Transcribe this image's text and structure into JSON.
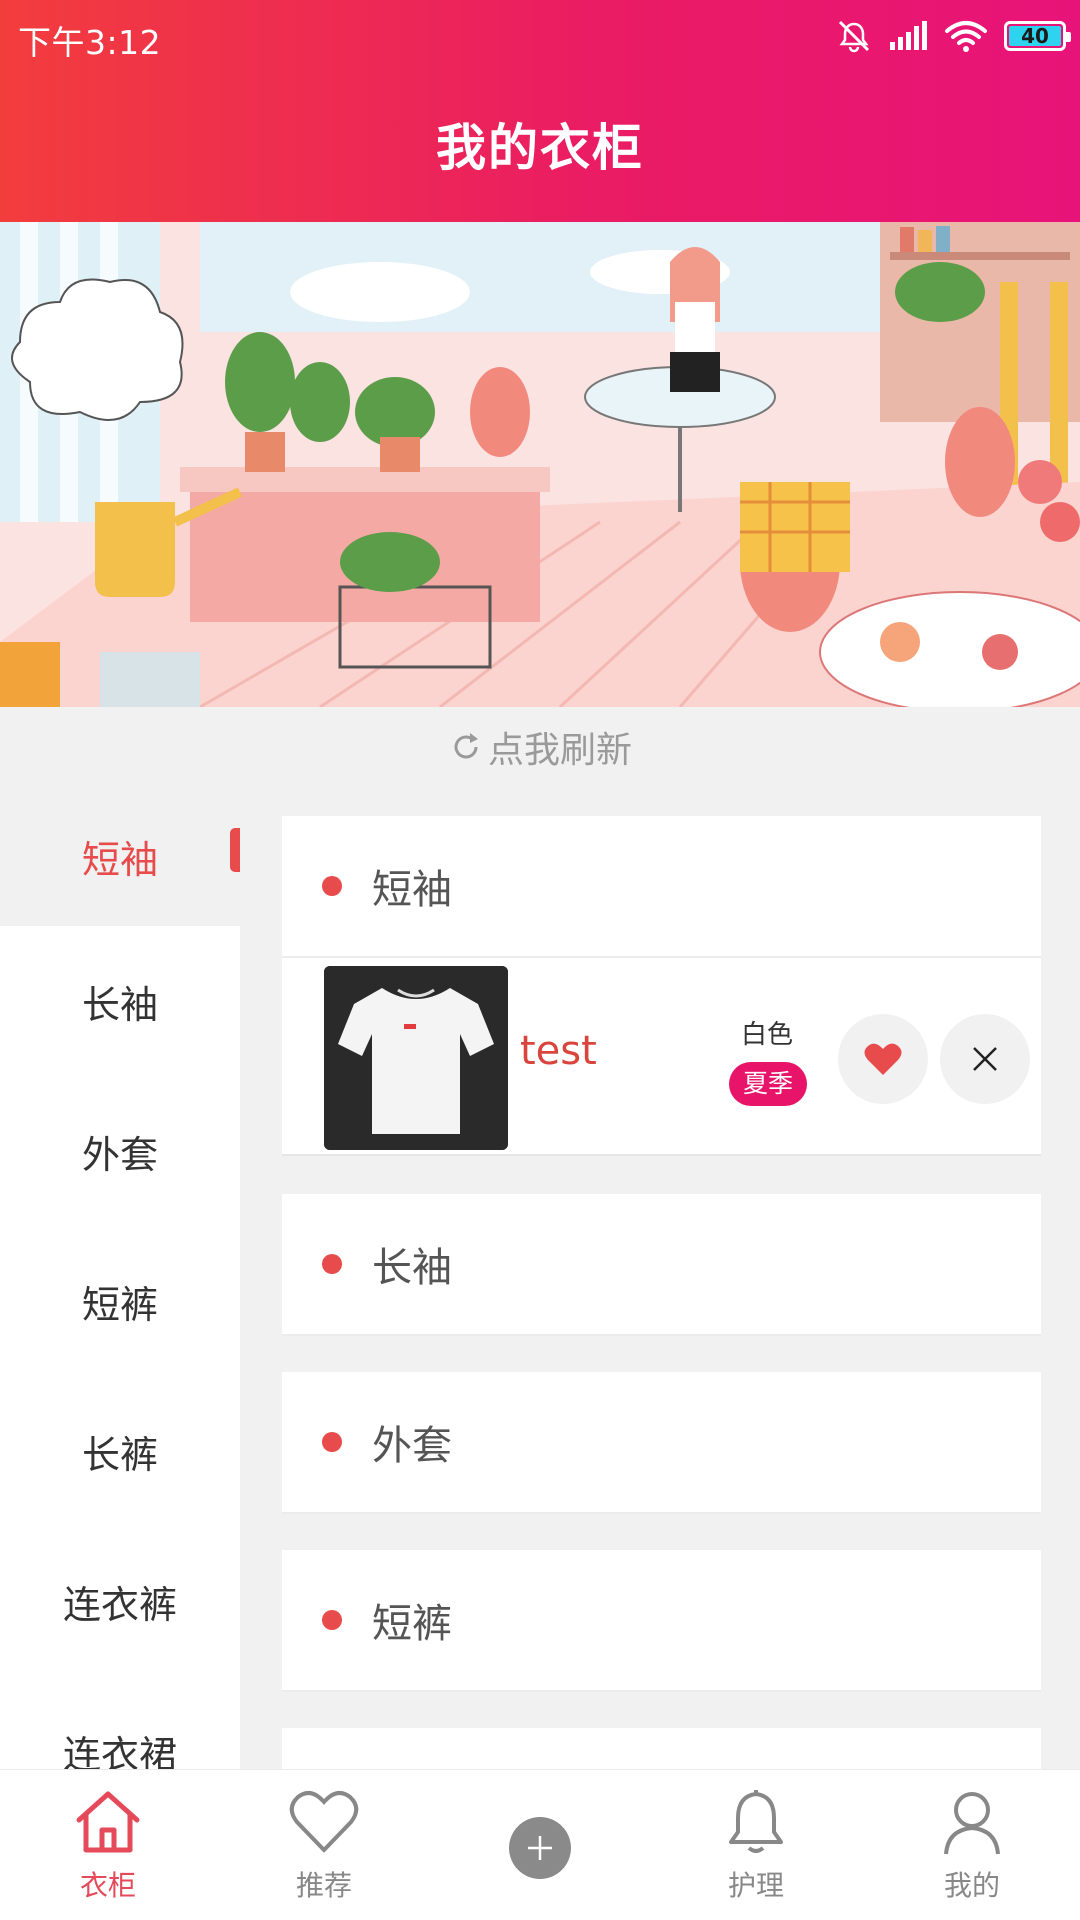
{
  "status_bar": {
    "time": "下午3:12",
    "battery": "40"
  },
  "header": {
    "title": "我的衣柜"
  },
  "refresh": {
    "label": "点我刷新"
  },
  "categories": [
    {
      "label": "短袖",
      "active": true
    },
    {
      "label": "长袖"
    },
    {
      "label": "外套"
    },
    {
      "label": "短裤"
    },
    {
      "label": "长裤"
    },
    {
      "label": "连衣裤"
    },
    {
      "label": "连衣裙"
    }
  ],
  "sections": [
    {
      "title": "短袖",
      "items": [
        {
          "name": "test",
          "color": "白色",
          "season": "夏季",
          "favorite": true
        }
      ]
    },
    {
      "title": "长袖"
    },
    {
      "title": "外套"
    },
    {
      "title": "短裤"
    }
  ],
  "bottom_nav": {
    "wardrobe": "衣柜",
    "recommend": "推荐",
    "care": "护理",
    "mine": "我的"
  },
  "colors": {
    "accent": "#e74b4b",
    "header_start": "#f23d3d",
    "header_end": "#e81379",
    "season_badge": "#e8146a"
  }
}
